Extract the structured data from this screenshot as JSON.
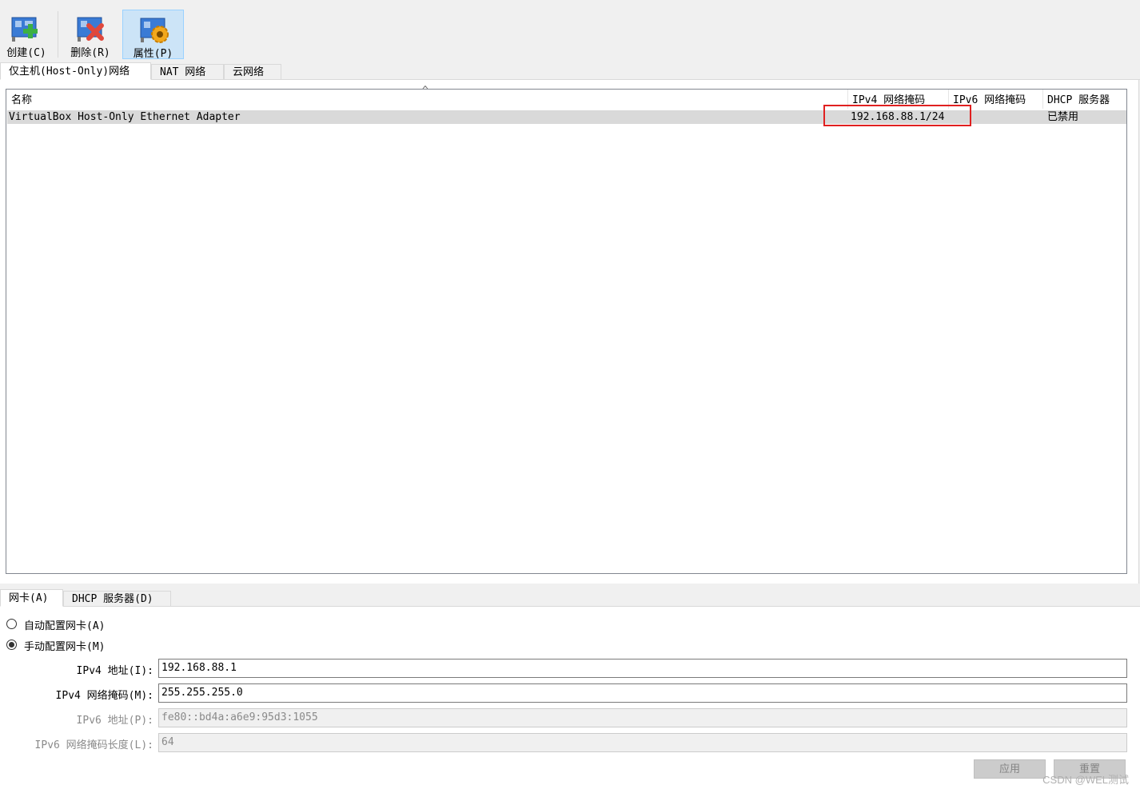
{
  "toolbar": {
    "create_label": "创建(C)",
    "remove_label": "删除(R)",
    "properties_label": "属性(P)"
  },
  "network_tabs": [
    {
      "label": "仅主机(Host-Only)网络",
      "selected": true
    },
    {
      "label": "NAT 网络",
      "selected": false
    },
    {
      "label": "云网络",
      "selected": false
    }
  ],
  "table": {
    "sort_indicator": "^",
    "columns": [
      "名称",
      "IPv4 网络掩码",
      "IPv6 网络掩码",
      "DHCP 服务器"
    ],
    "rows": [
      {
        "name": "VirtualBox Host-Only Ethernet Adapter",
        "ipv4": "192.168.88.1/24",
        "ipv6": "",
        "dhcp": "已禁用"
      }
    ],
    "highlight_color": "#e02020"
  },
  "detail_tabs": [
    {
      "label": "网卡(A)",
      "selected": true
    },
    {
      "label": "DHCP 服务器(D)",
      "selected": false
    }
  ],
  "adapter": {
    "auto_label": "自动配置网卡(A)",
    "manual_label": "手动配置网卡(M)",
    "mode": "manual",
    "ipv4_address_label": "IPv4 地址(I):",
    "ipv4_address_value": "192.168.88.1",
    "ipv4_mask_label": "IPv4 网络掩码(M):",
    "ipv4_mask_value": "255.255.255.0",
    "ipv6_address_label": "IPv6 地址(P):",
    "ipv6_address_value": "fe80::bd4a:a6e9:95d3:1055",
    "ipv6_prefix_label": "IPv6 网络掩码长度(L):",
    "ipv6_prefix_value": "64"
  },
  "buttons": {
    "apply_label": "应用",
    "reset_label": "重置"
  },
  "watermark": "CSDN @WEL测试"
}
